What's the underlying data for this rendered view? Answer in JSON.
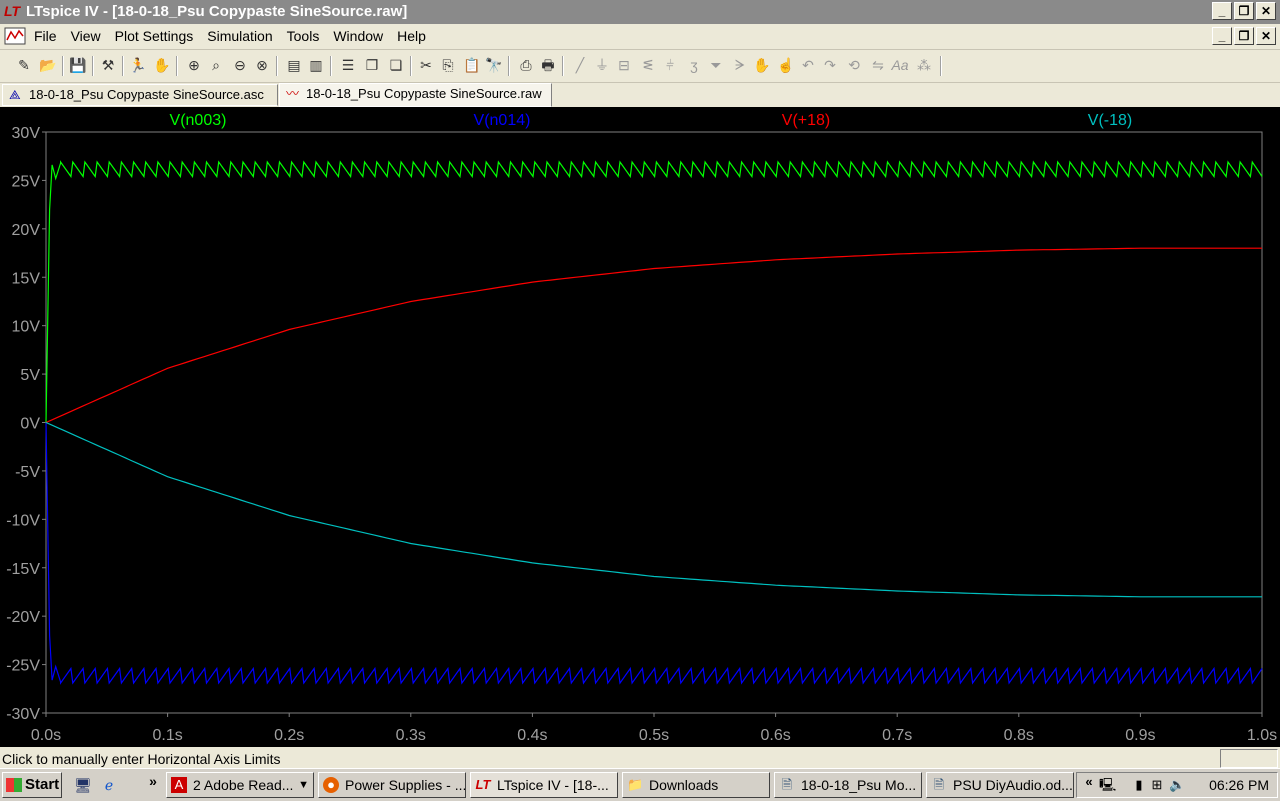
{
  "window": {
    "title": "LTspice IV - [18-0-18_Psu Copypaste SineSource.raw]",
    "app_icon": "LT",
    "buttons": [
      "_",
      "❐",
      "✕"
    ]
  },
  "menu": {
    "items": [
      "File",
      "View",
      "Plot Settings",
      "Simulation",
      "Tools",
      "Window",
      "Help"
    ]
  },
  "tabs": [
    {
      "label": "18-0-18_Psu Copypaste SineSource.asc",
      "icon": "schematic-icon",
      "active": false
    },
    {
      "label": "18-0-18_Psu Copypaste SineSource.raw",
      "icon": "waveform-icon",
      "active": true
    }
  ],
  "chart_data": {
    "type": "line",
    "title": "",
    "xlabel": "",
    "ylabel": "",
    "xlim": [
      0,
      1.0
    ],
    "ylim": [
      -30,
      30
    ],
    "x_ticks": [
      "0.0s",
      "0.1s",
      "0.2s",
      "0.3s",
      "0.4s",
      "0.5s",
      "0.6s",
      "0.7s",
      "0.8s",
      "0.9s",
      "1.0s"
    ],
    "y_ticks": [
      "30V",
      "25V",
      "20V",
      "15V",
      "10V",
      "5V",
      "0V",
      "-5V",
      "-10V",
      "-15V",
      "-20V",
      "-25V",
      "-30V"
    ],
    "series": [
      {
        "name": "V(n003)",
        "color": "#00ff00",
        "description_values": {
          "x": [
            0.0,
            0.005,
            0.01,
            0.02,
            0.1,
            0.3,
            0.5,
            0.7,
            0.9,
            1.0
          ],
          "y": [
            0,
            20,
            26.5,
            26.2,
            26.5,
            26.5,
            26.5,
            26.5,
            26.5,
            26.5
          ]
        },
        "ripple_pp": 1.5,
        "ripple_freq": 100
      },
      {
        "name": "V(n014)",
        "color": "#0000ff",
        "description_values": {
          "x": [
            0.0,
            0.005,
            0.01,
            0.02,
            0.1,
            0.3,
            0.5,
            0.7,
            0.9,
            1.0
          ],
          "y": [
            0,
            -20,
            -26.5,
            -26.2,
            -26.5,
            -26.5,
            -26.5,
            -26.5,
            -26.5,
            -26.5
          ]
        },
        "ripple_pp": 1.5,
        "ripple_freq": 100
      },
      {
        "name": "V(+18)",
        "color": "#ff0000",
        "description_values": {
          "x": [
            0.0,
            0.1,
            0.2,
            0.3,
            0.4,
            0.5,
            0.6,
            0.7,
            0.8,
            0.9,
            1.0
          ],
          "y": [
            0,
            5.6,
            9.6,
            12.5,
            14.5,
            15.9,
            16.8,
            17.4,
            17.8,
            18.0,
            18.0
          ]
        }
      },
      {
        "name": "V(-18)",
        "color": "#00c0c0",
        "description_values": {
          "x": [
            0.0,
            0.1,
            0.2,
            0.3,
            0.4,
            0.5,
            0.6,
            0.7,
            0.8,
            0.9,
            1.0
          ],
          "y": [
            0,
            -5.6,
            -9.6,
            -12.5,
            -14.5,
            -15.9,
            -16.8,
            -17.4,
            -17.8,
            -18.0,
            -18.0
          ]
        }
      }
    ],
    "grid": false,
    "legend": "top"
  },
  "status": {
    "text": "Click to manually enter Horizontal Axis Limits"
  },
  "taskbar": {
    "start_label": "Start",
    "tasks": [
      {
        "label": "2 Adobe Read...",
        "icon": "pdf-icon"
      },
      {
        "label": "Power Supplies - ...",
        "icon": "firefox-icon"
      },
      {
        "label": "LTspice IV - [18-...",
        "icon": "ltspice-icon"
      },
      {
        "label": "Downloads",
        "icon": "folder-icon"
      },
      {
        "label": "18-0-18_Psu Mo...",
        "icon": "document-icon"
      },
      {
        "label": "PSU DiyAudio.od...",
        "icon": "document-icon"
      }
    ],
    "clock": "06:26 PM",
    "chevron": "«",
    "quicklaunch_chevron": "»"
  }
}
